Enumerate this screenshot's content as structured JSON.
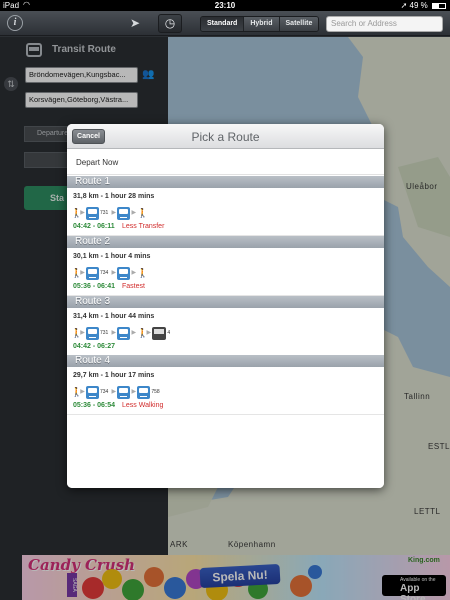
{
  "status": {
    "carrier": "iPad",
    "time": "23:10",
    "battery_label": "49 %",
    "battery_level": 0.49
  },
  "toolbar": {
    "map_types": [
      "Standard",
      "Hybrid",
      "Satellite"
    ],
    "active_map_type": "Standard",
    "search_placeholder": "Search or Address"
  },
  "panel": {
    "title": "Transit Route",
    "from_value": "Bröndomevägen,Kungsbac...",
    "to_value": "Korsvägen,Göteborg,Västra...",
    "departure_label": "Departure",
    "start_label": "Sta"
  },
  "map": {
    "labels": [
      "Uleåbor",
      "Tallinn",
      "ESTL",
      "LETTL",
      "Köpenhamn",
      "ARK"
    ]
  },
  "ad": {
    "logo_text": "Candy Crush",
    "logo_sub": "SAGA",
    "cta": "Spela Nu!",
    "brand": "King.com",
    "store_small": "Available on the",
    "store_big": "App Store"
  },
  "modal": {
    "title": "Pick a Route",
    "cancel_label": "Cancel",
    "depart_label": "Depart Now",
    "routes": [
      {
        "name": "Route 1",
        "summary": "31,8 km - 1 hour 28 mins",
        "legs": [
          "walk",
          "tram:731",
          "tram",
          "walk"
        ],
        "time": "04:42 - 06:11",
        "tag": "Less Transfer"
      },
      {
        "name": "Route 2",
        "summary": "30,1 km - 1 hour 4 mins",
        "legs": [
          "walk",
          "tram:734",
          "tram",
          "walk"
        ],
        "time": "05:36 - 06:41",
        "tag": "Fastest"
      },
      {
        "name": "Route 3",
        "summary": "31,4 km - 1 hour 44 mins",
        "legs": [
          "walk",
          "tram:731",
          "tram",
          "walk",
          "bus:4"
        ],
        "time": "04:42 - 06:27",
        "tag": ""
      },
      {
        "name": "Route 4",
        "summary": "29,7 km - 1 hour 17 mins",
        "legs": [
          "walk",
          "tram:734",
          "tram",
          "tram:758"
        ],
        "time": "05:36 - 06:54",
        "tag": "Less Walking"
      }
    ]
  }
}
